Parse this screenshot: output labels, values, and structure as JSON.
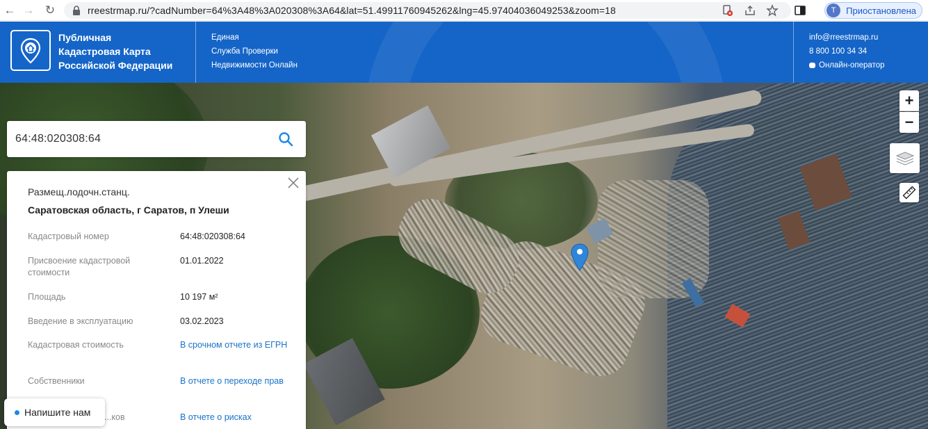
{
  "browser": {
    "url": "rreestrmap.ru/?cadNumber=64%3A48%3A020308%3A64&lat=51.49911760945262&lng=45.97404036049253&zoom=18",
    "profile_initial": "T",
    "profile_status": "Приостановлена"
  },
  "header": {
    "brand_line1": "Публичная",
    "brand_line2": "Кадастровая Карта",
    "brand_line3": "Российской Федерации",
    "service_line1": "Единая",
    "service_line2": "Служба Проверки",
    "service_line3": "Недвижимости Онлайн",
    "email": "info@rreestrmap.ru",
    "phone": "8 800 100 34 34",
    "operator": "Онлайн-оператор"
  },
  "search": {
    "value": "64:48:020308:64"
  },
  "panel": {
    "type": "Размещ.лодочн.станц.",
    "address": "Саратовская область, г Саратов, п Улеши",
    "rows": [
      {
        "label": "Кадастровый номер",
        "value": "64:48:020308:64"
      },
      {
        "label": "Присвоение кадастровой стоимости",
        "value": "01.01.2022"
      },
      {
        "label": "Площадь",
        "value": "10 197 м²"
      },
      {
        "label": "Введение в эксплуатацию",
        "value": "03.02.2023"
      },
      {
        "label": "Кадастровая стоимость",
        "value": "В срочном отчете из ЕГРН"
      },
      {
        "label": "Собственники",
        "value": "В отчете о переходе прав"
      },
      {
        "label": "...ков",
        "value": "В отчете о рисках"
      }
    ]
  },
  "map_controls": {
    "zoom_in": "+",
    "zoom_out": "−"
  },
  "chat": {
    "label": "Напишите нам"
  },
  "colors": {
    "header_bg": "#1565c8",
    "link": "#1a73c8",
    "marker": "#2f86d8"
  }
}
